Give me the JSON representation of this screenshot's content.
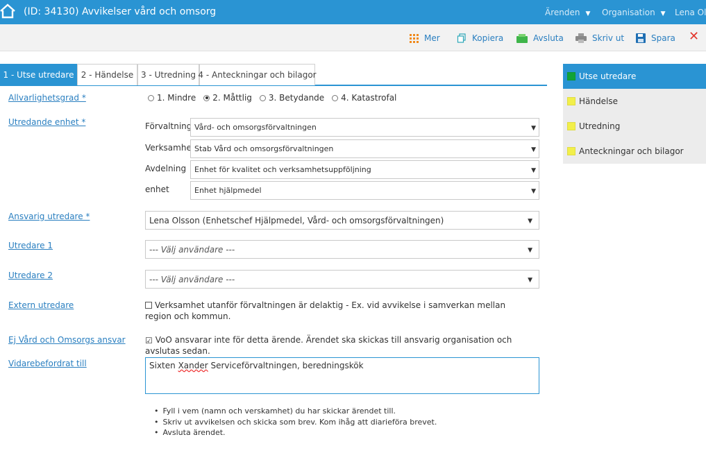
{
  "header": {
    "title": "(ID: 34130) Avvikelser vård och omsorg",
    "menu": [
      {
        "label": "Ärenden"
      },
      {
        "label": "Organisation"
      }
    ],
    "user": "Lena Ols"
  },
  "toolbar": {
    "more": "Mer",
    "copy": "Kopiera",
    "finish": "Avsluta",
    "print": "Skriv ut",
    "save": "Spara",
    "close": "✕"
  },
  "tabs": [
    {
      "label": "1 - Utse utredare"
    },
    {
      "label": "2 - Händelse"
    },
    {
      "label": "3 - Utredning"
    },
    {
      "label": "4 - Anteckningar och bilagor"
    }
  ],
  "panel": [
    {
      "label": "Utse utredare",
      "color": "#11a337"
    },
    {
      "label": "Händelse",
      "color": "#f2ef4a"
    },
    {
      "label": "Utredning",
      "color": "#f2ef4a"
    },
    {
      "label": "Anteckningar och bilagor",
      "color": "#f2ef4a"
    }
  ],
  "form": {
    "severity": {
      "label": "Allvarlighetsgrad *",
      "options": [
        "1. Mindre",
        "2. Måttlig",
        "3. Betydande",
        "4. Katastrofal"
      ],
      "selected": "2. Måttlig"
    },
    "unit": {
      "label": "Utredande enhet *",
      "rows": [
        {
          "label": "Förvaltning",
          "value": "Vård- och omsorgsförvaltningen"
        },
        {
          "label": "Verksamhet",
          "value": "Stab Vård och omsorgsförvaltningen"
        },
        {
          "label": "Avdelning",
          "value": "Enhet för kvalitet och verksamhetsuppföljning"
        },
        {
          "label": "enhet",
          "value": "Enhet hjälpmedel"
        }
      ]
    },
    "responsible": {
      "label": "Ansvarig utredare *",
      "value": "Lena Olsson (Enhetschef Hjälpmedel, Vård- och omsorgsförvaltningen)"
    },
    "inv1": {
      "label": "Utredare 1",
      "placeholder": "--- Välj användare ---"
    },
    "inv2": {
      "label": "Utredare 2",
      "placeholder": "--- Välj användare ---"
    },
    "external": {
      "label": "Extern utredare",
      "text": "Verksamhet utanför förvaltningen är delaktig - Ex. vid avvikelse i samverkan mellan region och kommun.",
      "checked": false
    },
    "notresp": {
      "label": "Ej Vård och Omsorgs ansvar",
      "text": "VoO ansvarar inte för detta ärende. Ärendet ska skickas till ansvarig organisation och avslutas sedan.",
      "checked": true,
      "mark": "☑"
    },
    "forward": {
      "label": "Vidarebefordrat till",
      "value_pre": "Sixten ",
      "value_misspelled": "Xander",
      "value_post": " Serviceförvaltningen, beredningskök"
    },
    "instructions": [
      "Fyll i vem (namn och verskamhet) du har skickar ärendet till.",
      "Skriv ut avvikelsen och skicka som brev. Kom ihåg att diarieföra brevet.",
      "Avsluta ärendet."
    ]
  }
}
